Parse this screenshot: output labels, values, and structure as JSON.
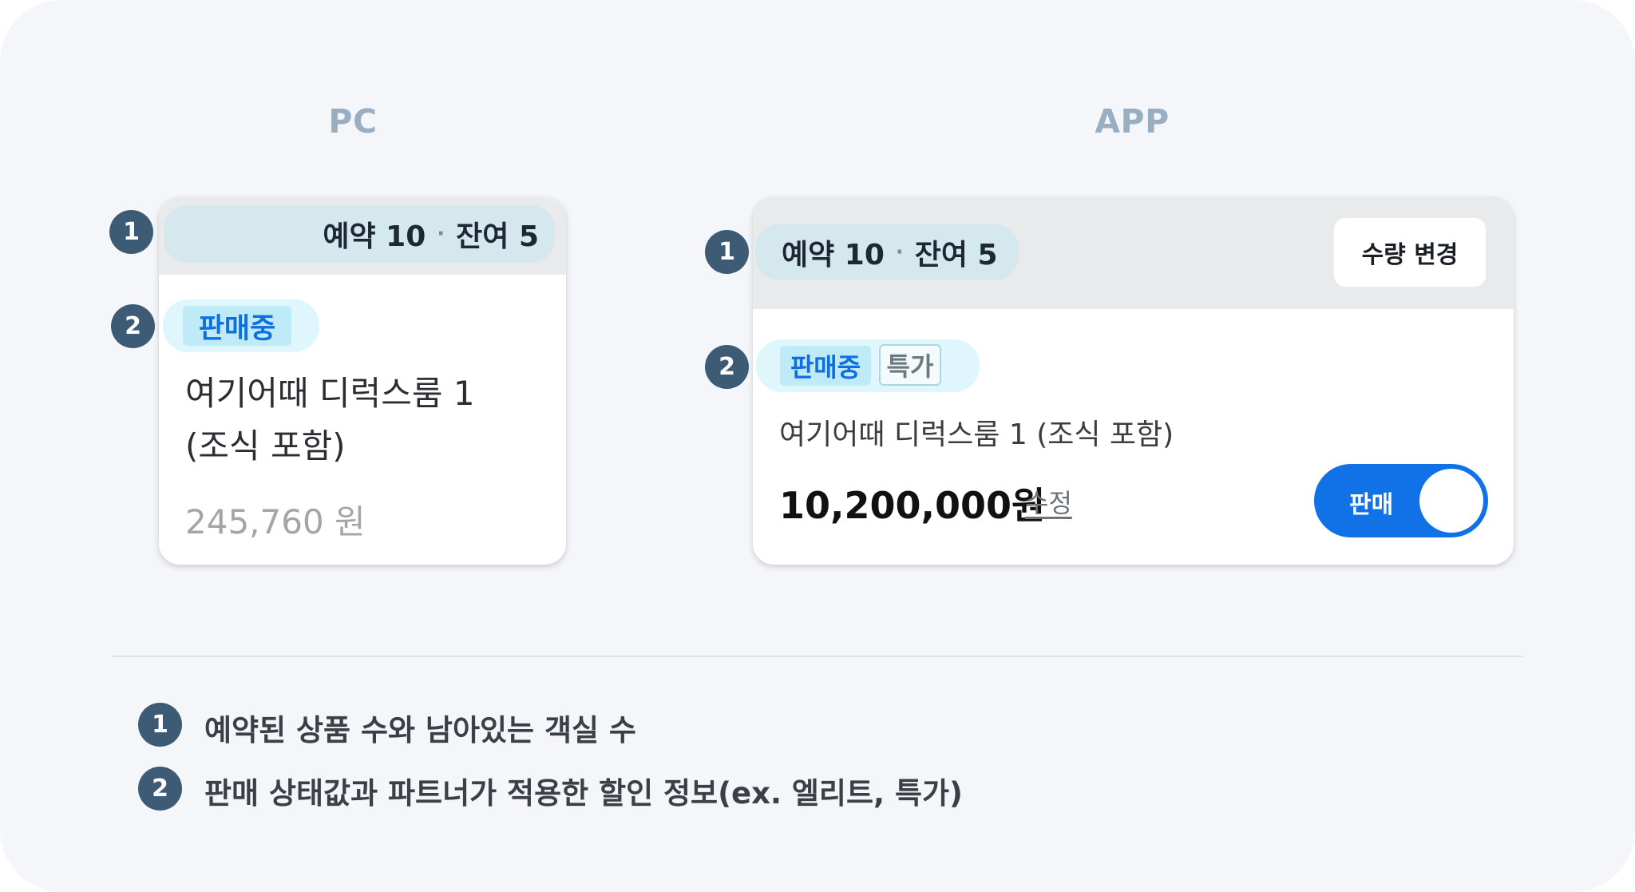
{
  "pc": {
    "title": "PC",
    "markers": [
      "1",
      "2"
    ],
    "count_reserved": "예약 10",
    "count_separator": "·",
    "count_remaining": "잔여 5",
    "status_tag": "판매중",
    "room_name_line1": "여기어때 디럭스룸 1",
    "room_name_line2": "(조식 포함)",
    "price": "245,760 원"
  },
  "app": {
    "title": "APP",
    "markers": [
      "1",
      "2"
    ],
    "count_reserved": "예약 10",
    "count_separator": "·",
    "count_remaining": "잔여 5",
    "qty_change_label": "수량 변경",
    "status_tag": "판매중",
    "special_tag": "특가",
    "room_name": "여기어때 디럭스룸 1 (조식 포함)",
    "price": "10,200,000원",
    "edit_label": "수정",
    "toggle_label": "판매",
    "toggle_on": true
  },
  "legend": [
    {
      "number": "1",
      "text": "예약된 상품 수와 남아있는 객실 수"
    },
    {
      "number": "2",
      "text": "판매 상태값과 파트너가 적용한 할인 정보(ex. 엘리트, 특가)"
    }
  ],
  "colors": {
    "background": "#f4f6fa",
    "marker": "#3e5b75",
    "accent_blue": "#1172e8",
    "count_pill": "#d5e8ee",
    "section_title": "#9aaec2"
  }
}
